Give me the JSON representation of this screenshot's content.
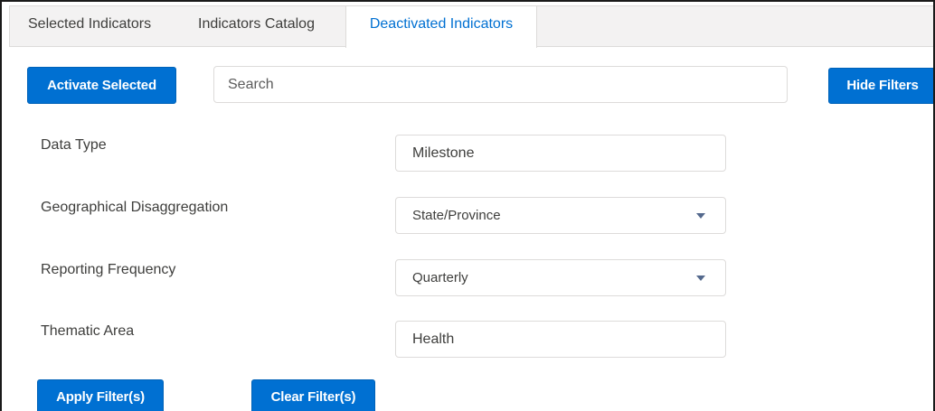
{
  "tabs": [
    {
      "label": "Selected Indicators"
    },
    {
      "label": "Indicators Catalog"
    },
    {
      "label": "Deactivated Indicators",
      "active": true
    }
  ],
  "toolbar": {
    "activate_label": "Activate Selected",
    "search_placeholder": "Search",
    "hide_filters_label": "Hide Filters"
  },
  "filters": {
    "data_type": {
      "label": "Data Type",
      "value": "Milestone"
    },
    "geo_disaggregation": {
      "label": "Geographical Disaggregation",
      "value": "State/Province",
      "icon": "chevron-down-icon"
    },
    "reporting_frequency": {
      "label": "Reporting Frequency",
      "value": "Quarterly",
      "icon": "chevron-down-icon"
    },
    "thematic_area": {
      "label": "Thematic Area",
      "value": "Health"
    }
  },
  "actions": {
    "apply_label": "Apply Filter(s)",
    "clear_label": "Clear Filter(s)"
  },
  "colors": {
    "accent": "#0070d2",
    "tab_bar": "#f3f2f2",
    "border": "#dddbda",
    "text": "#3e3e3c"
  }
}
